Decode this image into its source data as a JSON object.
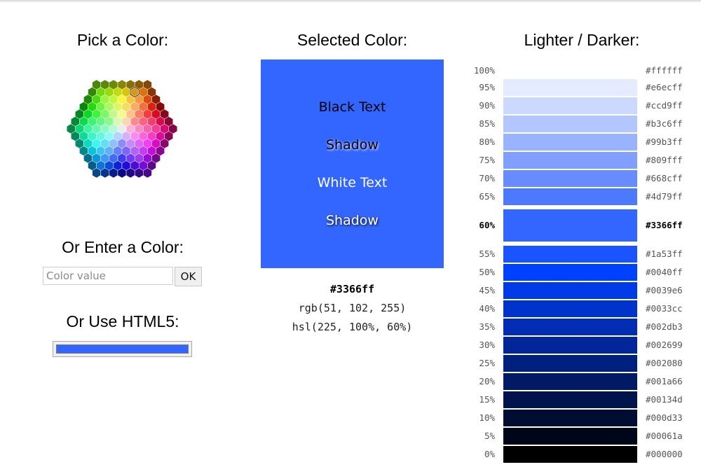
{
  "picker": {
    "title": "Pick a Color:",
    "enter_title": "Or Enter a Color:",
    "input_value": "",
    "input_placeholder": "Color value",
    "ok_label": "OK",
    "html5_title": "Or Use HTML5:",
    "html5_color": "#3366ff"
  },
  "selected": {
    "title": "Selected Color:",
    "color": "#3366ff",
    "black_text": "Black Text",
    "black_shadow": "Shadow",
    "white_text": "White Text",
    "white_shadow": "Shadow",
    "hex": "#3366ff",
    "rgb": "rgb(51, 102, 255)",
    "hsl": "hsl(225, 100%, 60%)"
  },
  "shades": {
    "title": "Lighter / Darker:",
    "items": [
      {
        "pct": "100%",
        "hex": "#ffffff"
      },
      {
        "pct": "95%",
        "hex": "#e6ecff"
      },
      {
        "pct": "90%",
        "hex": "#ccd9ff"
      },
      {
        "pct": "85%",
        "hex": "#b3c6ff"
      },
      {
        "pct": "80%",
        "hex": "#99b3ff"
      },
      {
        "pct": "75%",
        "hex": "#809fff"
      },
      {
        "pct": "70%",
        "hex": "#668cff"
      },
      {
        "pct": "65%",
        "hex": "#4d79ff"
      },
      {
        "pct": "60%",
        "hex": "#3366ff",
        "selected": true
      },
      {
        "pct": "55%",
        "hex": "#1a53ff"
      },
      {
        "pct": "50%",
        "hex": "#0040ff"
      },
      {
        "pct": "45%",
        "hex": "#0039e6"
      },
      {
        "pct": "40%",
        "hex": "#0033cc"
      },
      {
        "pct": "35%",
        "hex": "#002db3"
      },
      {
        "pct": "30%",
        "hex": "#002699"
      },
      {
        "pct": "25%",
        "hex": "#002080"
      },
      {
        "pct": "20%",
        "hex": "#001a66"
      },
      {
        "pct": "15%",
        "hex": "#00134d"
      },
      {
        "pct": "10%",
        "hex": "#000d33"
      },
      {
        "pct": "5%",
        "hex": "#00061a"
      },
      {
        "pct": "0%",
        "hex": "#000000"
      }
    ]
  }
}
